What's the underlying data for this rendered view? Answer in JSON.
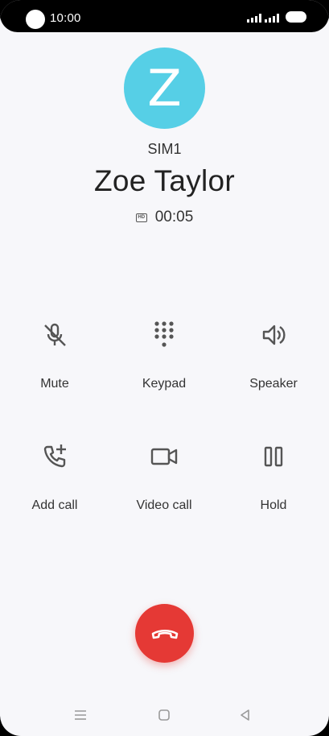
{
  "status": {
    "time": "10:00"
  },
  "caller": {
    "avatar_letter": "Z",
    "avatar_color": "#56cfe6",
    "sim": "SIM1",
    "name": "Zoe Taylor",
    "hd_badge": "HD",
    "duration": "00:05"
  },
  "actions": [
    {
      "label": "Mute",
      "icon": "mic-off-icon"
    },
    {
      "label": "Keypad",
      "icon": "dialpad-icon"
    },
    {
      "label": "Speaker",
      "icon": "speaker-icon"
    },
    {
      "label": "Add call",
      "icon": "add-call-icon"
    },
    {
      "label": "Video call",
      "icon": "video-camera-icon"
    },
    {
      "label": "Hold",
      "icon": "pause-icon"
    }
  ],
  "end_call": {
    "icon": "hang-up-icon",
    "color": "#e53935"
  },
  "navbar": {
    "items": [
      "menu-icon",
      "home-icon",
      "back-icon"
    ]
  }
}
